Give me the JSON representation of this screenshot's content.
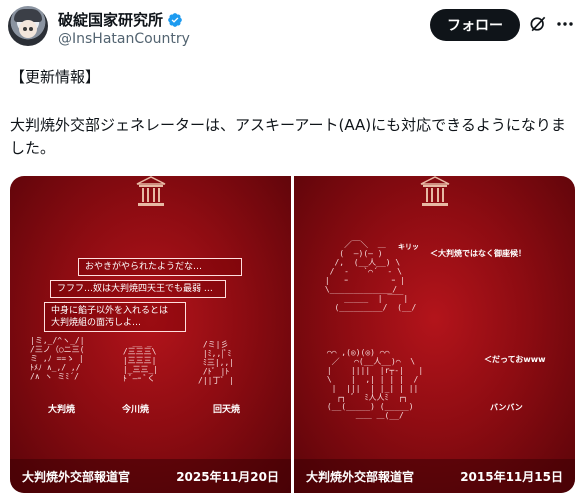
{
  "account": {
    "display_name": "破綻国家研究所",
    "handle": "@InsHatanCountry",
    "verified": true
  },
  "actions": {
    "follow_label": "フォロー",
    "grok_icon": "grok-icon",
    "more_icon": "more-icon"
  },
  "tweet": {
    "line1": "【更新情報】",
    "body": "大判焼外交部ジェネレーターは、アスキーアート(AA)にも対応できるようになりました。"
  },
  "media": {
    "left": {
      "bubbles": [
        "おやきがやられたようだな…",
        "フフフ…奴は大判焼四天王でも最弱 …",
        "中身に餡子以外を入れるとは\n大判焼組の面汚しよ…"
      ],
      "labels": [
        "大判焼",
        "今川焼",
        "回天焼"
      ],
      "footer_name": "大判焼外交部報道官",
      "footer_date": "2025年11月20日"
    },
    "right": {
      "texts": [
        "キリッ",
        "＜大判焼ではなく御座候！",
        "＜だっておwww",
        "バンバン"
      ],
      "footer_name": "大判焼外交部報道官",
      "footer_date": "2015年11月15日"
    }
  },
  "colors": {
    "panel_red": "#8e0c12",
    "follow_bg": "#0f1419",
    "verified_blue": "#1d9bf0"
  }
}
